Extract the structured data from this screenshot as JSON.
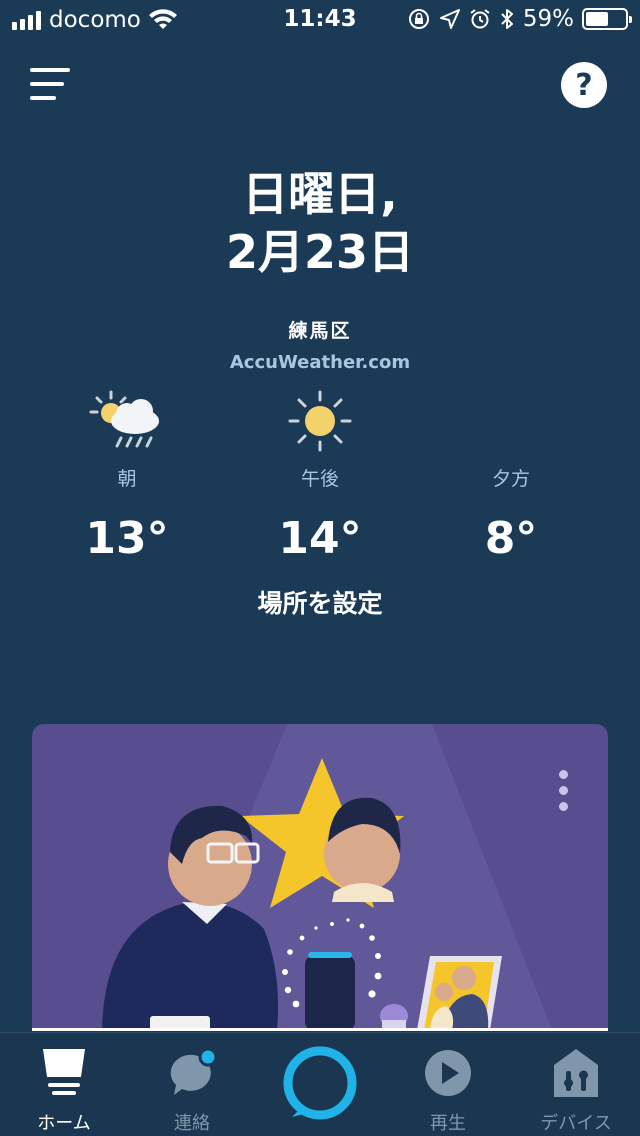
{
  "status_bar": {
    "carrier": "docomo",
    "time": "11:43",
    "battery": "59%",
    "battery_level": 0.59
  },
  "header": {
    "help_label": "?"
  },
  "date": {
    "weekday": "日曜日,",
    "day": "2月23日"
  },
  "weather": {
    "location": "練馬区",
    "source": "AccuWeather.com",
    "periods": [
      {
        "label": "朝",
        "temp": "13°",
        "icon": "partly-cloudy-rain-icon"
      },
      {
        "label": "午後",
        "temp": "14°",
        "icon": "sun-icon"
      },
      {
        "label": "夕方",
        "temp": "8°",
        "icon": "moon-icon"
      }
    ],
    "set_location": "場所を設定"
  },
  "card": {
    "illustration": "man-with-echo-show-and-star-photo",
    "menu_icon": "more-vertical-icon"
  },
  "tabbar": {
    "tabs": [
      {
        "label": "ホーム",
        "icon": "home-icon",
        "active": true
      },
      {
        "label": "連絡",
        "icon": "chat-icon",
        "active": false
      },
      {
        "label": "",
        "icon": "alexa-ring-icon",
        "active": false
      },
      {
        "label": "再生",
        "icon": "play-icon",
        "active": false
      },
      {
        "label": "デバイス",
        "icon": "devices-icon",
        "active": false
      }
    ]
  },
  "colors": {
    "background": "#1b3a56",
    "accent": "#1fb3e8",
    "muted_text": "#a9c6e0",
    "card": "#584e8f"
  }
}
